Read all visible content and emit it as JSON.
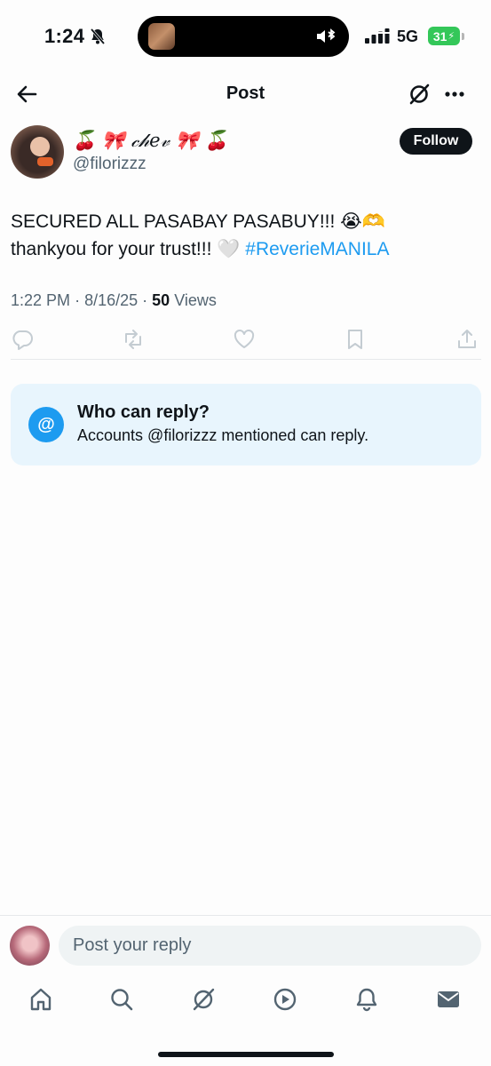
{
  "status_bar": {
    "time": "1:24",
    "network": "5G",
    "battery": "31",
    "icons": [
      "bell-off-icon",
      "bluetooth-icon",
      "cellular-signal-icon"
    ]
  },
  "header": {
    "title": "Post",
    "icons": [
      "back-arrow-icon",
      "grok-icon",
      "more-icon"
    ]
  },
  "post": {
    "author": {
      "display_name": "🍒 🎀 𝒸𝒽𝑒𝓋 🎀 🍒",
      "handle": "@filorizzz",
      "follow_label": "Follow"
    },
    "text_line1": "SECURED ALL PASABAY PASABUY!!! 😭🫶",
    "text_line2_prefix": "thankyou for your trust!!! 🤍 ",
    "hashtag": "#ReverieMANILA",
    "time": "1:22 PM",
    "date": "8/16/25",
    "views_count": "50",
    "views_label": "Views",
    "separator": "·"
  },
  "who_can_reply": {
    "title": "Who can reply?",
    "description": "Accounts @filorizzz mentioned can reply.",
    "badge": "@"
  },
  "reply": {
    "placeholder": "Post your reply"
  },
  "tabs": [
    "home-icon",
    "search-icon",
    "grok-icon",
    "video-icon",
    "notifications-icon",
    "messages-icon"
  ],
  "colors": {
    "accent": "#1d9bf0",
    "text": "#0f1419",
    "secondary": "#536471",
    "battery": "#34c759",
    "info_box": "#e8f5fd"
  }
}
